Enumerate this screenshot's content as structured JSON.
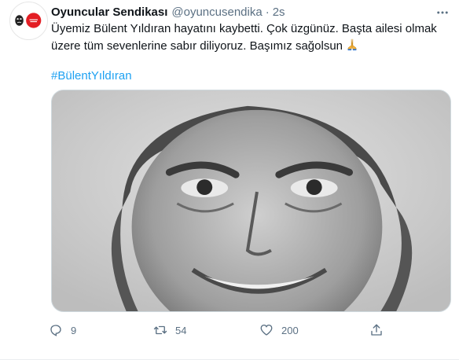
{
  "tweet": {
    "display_name": "Oyuncular Sendikası",
    "handle": "@oyuncusendika",
    "separator": "·",
    "time": "2s",
    "text_line1": "Üyemiz Bülent Yıldıran hayatını kaybetti. Çok üzgünüz. Başta ailesi olmak",
    "text_line2": "üzere tüm sevenlerine sabır diliyoruz. Başımız sağolsun",
    "emoji": "folded-hands",
    "hashtag": "#BülentYıldıran"
  },
  "actions": {
    "reply_count": "9",
    "retweet_count": "54",
    "like_count": "200"
  },
  "colors": {
    "link": "#1da1f2",
    "secondary_text": "#5b7083",
    "primary_text": "#0f1419",
    "avatar_accent": "#e31e24"
  },
  "icons": [
    "more-icon",
    "reply-icon",
    "retweet-icon",
    "like-icon",
    "share-icon"
  ]
}
